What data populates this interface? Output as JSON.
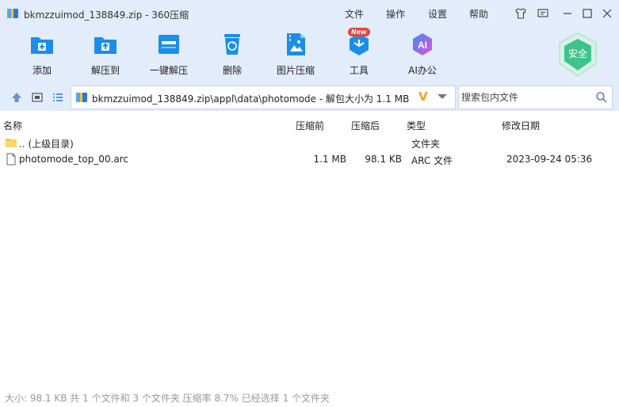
{
  "window": {
    "title": "bkmzzuimod_138849.zip - 360压缩",
    "menu": [
      "文件",
      "操作",
      "设置",
      "帮助"
    ]
  },
  "toolbar": {
    "add": "添加",
    "extract_to": "解压到",
    "one_click": "一键解压",
    "delete": "删除",
    "image_compress": "图片压缩",
    "tools": "工具",
    "tools_badge": "New",
    "ai_office": "AI办公",
    "ai_icon_text": "AI"
  },
  "security": {
    "label": "安全"
  },
  "address": {
    "path": "bkmzzuimod_138849.zip\\appl\\data\\photomode - 解包大小为 1.1 MB",
    "v_mark": "V"
  },
  "search": {
    "placeholder": "搜索包内文件"
  },
  "columns": {
    "name": "名称",
    "before": "压缩前",
    "after": "压缩后",
    "type": "类型",
    "modified": "修改日期"
  },
  "rows": [
    {
      "name": ".. (上级目录)",
      "before": "",
      "after": "",
      "type": "文件夹",
      "modified": ""
    },
    {
      "name": "photomode_top_00.arc",
      "before": "1.1 MB",
      "after": "98.1 KB",
      "type": "ARC 文件",
      "modified": "2023-09-24 05:36"
    }
  ],
  "status": "大小: 98.1 KB 共 1 个文件和 3 个文件夹 压缩率 8.7% 已经选择 1 个文件夹",
  "colors": {
    "header_bg": "#e2ecfa",
    "accent": "#1a8ee8",
    "v_mark": "#f3a41a",
    "shield": "#3ec38a"
  }
}
